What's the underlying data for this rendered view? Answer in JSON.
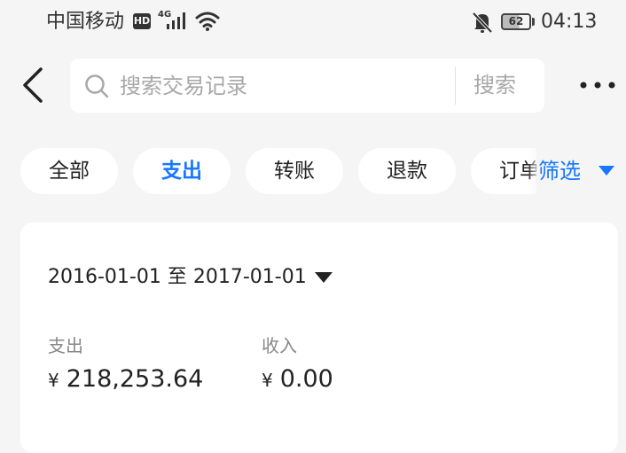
{
  "status_bar": {
    "carrier": "中国移动",
    "hd": "HD",
    "network": "4G",
    "battery": "62",
    "time": "04:13"
  },
  "search": {
    "placeholder": "搜索交易记录",
    "button_label": "搜索"
  },
  "filters": {
    "chips": [
      {
        "label": "全部",
        "active": false
      },
      {
        "label": "支出",
        "active": true
      },
      {
        "label": "转账",
        "active": false
      },
      {
        "label": "退款",
        "active": false
      },
      {
        "label": "订单",
        "active": false
      }
    ],
    "filter_label": "筛选"
  },
  "summary": {
    "date_range": "2016-01-01 至 2017-01-01",
    "expense": {
      "label": "支出",
      "currency": "¥",
      "value": "218,253.64"
    },
    "income": {
      "label": "收入",
      "currency": "¥",
      "value": "0.00"
    }
  },
  "colors": {
    "accent": "#1677ff",
    "background": "#f5f5f5",
    "card": "#ffffff"
  }
}
